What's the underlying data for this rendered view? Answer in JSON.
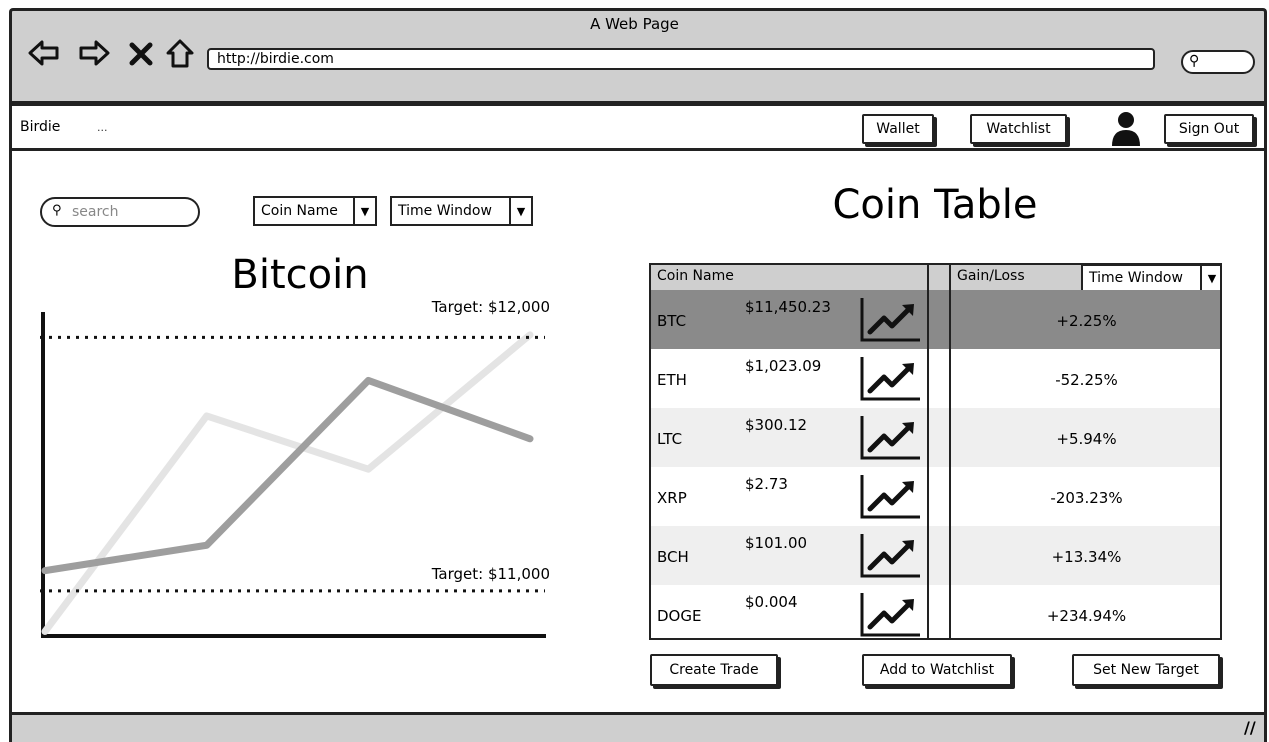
{
  "browser": {
    "title": "A Web Page",
    "url": "http://birdie.com"
  },
  "nav": {
    "brand": "Birdie",
    "ellipsis": "...",
    "wallet_label": "Wallet",
    "watchlist_label": "Watchlist",
    "signout_label": "Sign Out"
  },
  "filters": {
    "search_placeholder": "search",
    "coin_dropdown": "Coin Name",
    "time_dropdown": "Time Window"
  },
  "chart": {
    "title": "Bitcoin",
    "upper_target": "Target: $12,000",
    "lower_target": "Target: $11,000"
  },
  "chart_data": {
    "type": "line",
    "title": "Bitcoin",
    "x": [
      0,
      1,
      2,
      3
    ],
    "series": [
      {
        "values": [
          11080,
          11180,
          11830,
          11600
        ],
        "color": "#9e9e9e"
      },
      {
        "values": [
          10840,
          11690,
          11480,
          12010
        ],
        "color": "#e4e4e4"
      }
    ],
    "ylim": [
      10830,
      12100
    ],
    "reference_lines": [
      {
        "label": "Target: $12,000",
        "value": 12000
      },
      {
        "label": "Target: $11,000",
        "value": 11000
      }
    ],
    "grid": false
  },
  "coin_table": {
    "heading": "Coin Table",
    "col_name": "Coin Name",
    "col_gain": "Gain/Loss",
    "time_dropdown": "Time Window",
    "rows": [
      {
        "coin": "BTC",
        "price": "$11,450.23",
        "change": "+2.25%"
      },
      {
        "coin": "ETH",
        "price": "$1,023.09",
        "change": "-52.25%"
      },
      {
        "coin": "LTC",
        "price": "$300.12",
        "change": "+5.94%"
      },
      {
        "coin": "XRP",
        "price": "$2.73",
        "change": "-203.23%"
      },
      {
        "coin": "BCH",
        "price": "$101.00",
        "change": "+13.34%"
      },
      {
        "coin": "DOGE",
        "price": "$0.004",
        "change": "+234.94%"
      }
    ]
  },
  "actions": {
    "create_trade": "Create Trade",
    "add_watchlist": "Add to Watchlist",
    "set_target": "Set New Target"
  },
  "colors": {
    "selected_row": "#8a8a8a",
    "alt_row": "#efefef",
    "chrome": "#cfcfcf"
  }
}
